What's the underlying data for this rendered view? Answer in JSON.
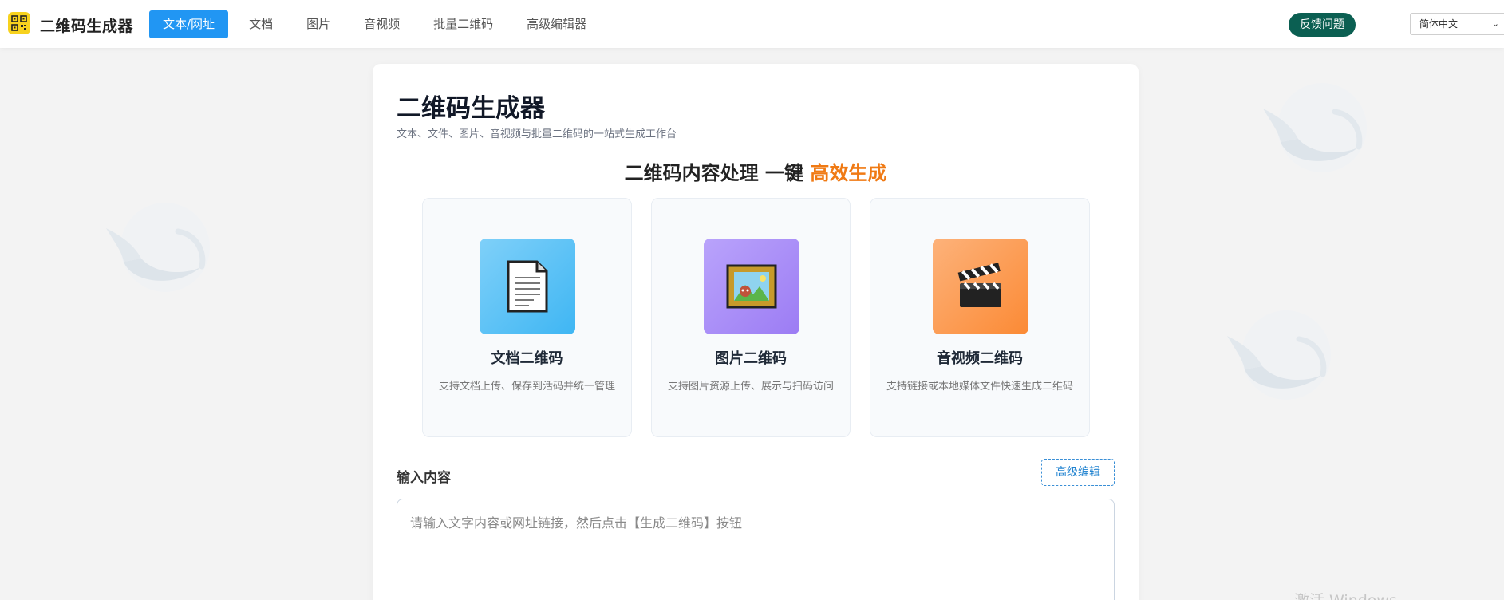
{
  "header": {
    "brand": "二维码生成器",
    "nav": [
      "文本/网址",
      "文档",
      "图片",
      "音视频",
      "批量二维码",
      "高级编辑器"
    ],
    "active_tab_index": 0,
    "feedback_label": "反馈问题",
    "language": "简体中文"
  },
  "main": {
    "title": "二维码生成器",
    "subtitle": "文本、文件、图片、音视频与批量二维码的一站式生成工作台",
    "hero_prefix": "二维码内容处理 一键 ",
    "hero_accent": "高效生成",
    "features": [
      {
        "name": "文档二维码",
        "desc": "支持文档上传、保存到活码并统一管理",
        "icon": "document-icon"
      },
      {
        "name": "图片二维码",
        "desc": "支持图片资源上传、展示与扫码访问",
        "icon": "framed-picture-icon"
      },
      {
        "name": "音视频二维码",
        "desc": "支持链接或本地媒体文件快速生成二维码",
        "icon": "clapperboard-icon"
      }
    ],
    "input_label": "输入内容",
    "advanced_edit_label": "高级编辑",
    "input_placeholder": "请输入文字内容或网址链接，然后点击【生成二维码】按钮",
    "input_value": ""
  },
  "system": {
    "watermark": "激活 Windows"
  },
  "colors": {
    "nav_active": "#2196f3",
    "feedback": "#0b5f52",
    "accent": "#f07a14",
    "doc_tile": "#4fc3f7",
    "img_tile": "#a78bfa",
    "media_tile": "#fb923c"
  }
}
